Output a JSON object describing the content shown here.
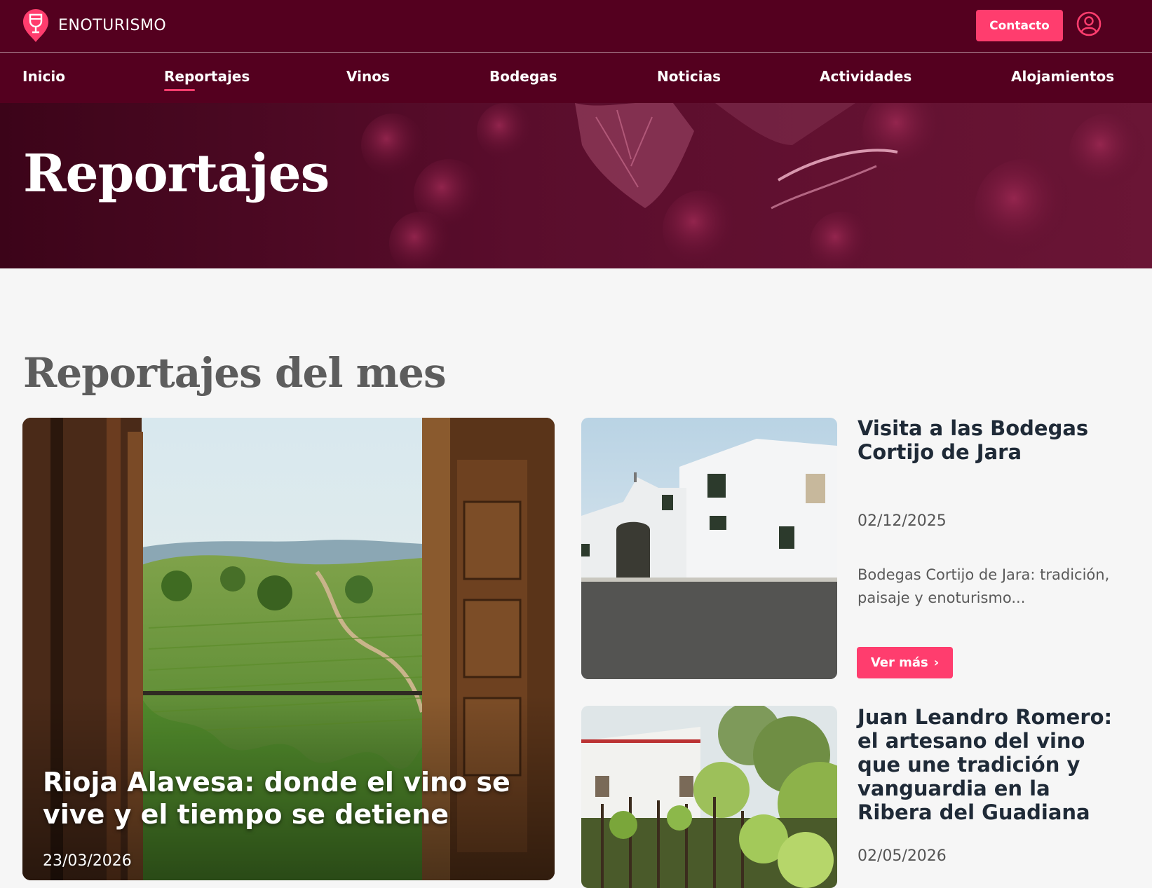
{
  "header": {
    "logo_text": "ENOTURISMO",
    "contact_label": "Contacto",
    "brand_color": "#54001f",
    "accent_color": "#ff3d6e",
    "icons": {
      "logo": "wine-glass-pin-icon",
      "user": "user-circle-icon"
    }
  },
  "nav": {
    "items": [
      {
        "label": "Inicio"
      },
      {
        "label": "Reportajes",
        "active": true
      },
      {
        "label": "Vinos"
      },
      {
        "label": "Bodegas"
      },
      {
        "label": "Noticias"
      },
      {
        "label": "Actividades"
      },
      {
        "label": "Alojamientos"
      }
    ]
  },
  "hero": {
    "title": "Reportajes"
  },
  "section": {
    "title": "Reportajes del mes"
  },
  "featured": {
    "title": "Rioja Alavesa: donde el vino se vive y el tiempo se detiene",
    "date": "23/03/2026"
  },
  "articles": [
    {
      "title": "Visita a las Bodegas Cortijo de Jara",
      "date": "02/12/2025",
      "excerpt": "Bodegas Cortijo de Jara: tradición, paisaje y enoturismo...",
      "cta": "Ver más",
      "cta_icon": "chevron-right-icon"
    },
    {
      "title": "Juan Leandro Romero: el artesano del vino que une tradición y vanguardia en la Ribera del Guadiana",
      "date": "02/05/2026"
    }
  ]
}
